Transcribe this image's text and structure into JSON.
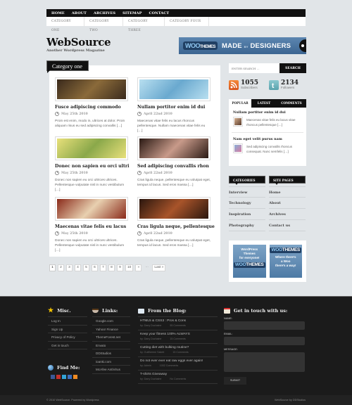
{
  "top_nav": [
    "HOME",
    "ABOUT",
    "ARCHIVES",
    "SITEMAP",
    "CONTACT"
  ],
  "category_nav": [
    "CATEGORY ONE",
    "CATEGORY TWO",
    "CATEGORY THREE",
    "CATEGORY FOUR"
  ],
  "logo": {
    "title": "WebSource",
    "tagline": "Another Wordpress Magazine"
  },
  "banner": {
    "woo": "WOO",
    "themes": "THEMES",
    "made": "MADE",
    "by": "BY",
    "designers": "DESIGNERS"
  },
  "main": {
    "category_title": "Category one",
    "posts": [
      {
        "title": "Fusce adipiscing commodo",
        "date": "May 25th 2010",
        "excerpt": "Proin est enim, modo in, ultrices at dolor. Proin aliquam risus eu sed adipiscing convallis […]",
        "colors": [
          "#3a2a1c",
          "#8a6a3a"
        ]
      },
      {
        "title": "Nullam portitor enim id dui",
        "date": "April 22nd 2010",
        "excerpt": "Maecenas vitae felis eu lacus rhoncus pellentesque. Nullam maecenas vitae felis eu […]",
        "colors": [
          "#b8dff0",
          "#6aa9cf"
        ]
      },
      {
        "title": "Donec non sapien eu orci ultri",
        "date": "May 25th 2010",
        "excerpt": "Donec non sapien eu orci ultrices ultrices. Pellentesque vulputate nisl in nunc vestibulum […]",
        "colors": [
          "#e8e07a",
          "#8aa84a"
        ]
      },
      {
        "title": "Sed adipiscing convallis rhon",
        "date": "April 22nd 2010",
        "excerpt": "Cras ligula neque, pellentesque eu volutpat eget, tempus id lacus. Sed eros massa […]",
        "colors": [
          "#2a1a14",
          "#c89a8a"
        ]
      },
      {
        "title": "Maecenas vitae felis eu lacus",
        "date": "May 25th 2010",
        "excerpt": "Donec non sapien eu orci ultrices ultrices. Pellentesque vulputate nisl in nunc vestibulum […]",
        "colors": [
          "#8a2a1a",
          "#e8d0b0"
        ]
      },
      {
        "title": "Cras ligula neque, pellentesque",
        "date": "April 22nd 2010",
        "excerpt": "Cras ligula neque, pellentesque eu volutpat eget, tempus id lacus. Sed eros massa […]",
        "colors": [
          "#2a160e",
          "#a8542a"
        ]
      }
    ]
  },
  "pagination": {
    "pages": [
      "1",
      "2",
      "3",
      "4",
      "5",
      "6",
      "7",
      "8",
      "9",
      "10"
    ],
    "next": "»",
    "dots": "...",
    "last": "Last »",
    "current": "1"
  },
  "sidebar": {
    "search": {
      "placeholder": "ENTER SEARCH ...",
      "button": "SEARCH"
    },
    "subscribers": {
      "count": "1055",
      "label": "Subscribers"
    },
    "followers": {
      "count": "2134",
      "label": "Followers"
    },
    "tabs": [
      "POPULAR",
      "LATEST",
      "COMMENTS"
    ],
    "active_tab": "POPULAR",
    "popular": [
      {
        "title": "Nullam portitor enim id dui",
        "excerpt": "Maecenas vitae felis eu lacus vitae rhoncus pellentesque […]"
      },
      {
        "title": "Nam eget velit purus nam",
        "excerpt": "Sed adipiscing convallis rhoncus consequat. Nunc semfelis […]"
      }
    ],
    "categories": {
      "title": "CATEGORIES",
      "items": [
        "Interview",
        "Technology",
        "Inspiration",
        "Photography"
      ]
    },
    "site_pages": {
      "title": "SITE PAGES",
      "items": [
        "Home",
        "About",
        "Archives",
        "Contact us"
      ]
    },
    "ads": [
      {
        "line1": "WordPress",
        "line2": "Themes",
        "line3": "for everyone!"
      },
      {
        "line1": "Where there's",
        "line2": "a Woo",
        "line3": "there's a way!"
      }
    ]
  },
  "footer": {
    "misc": {
      "title": "Misc.",
      "items": [
        "Log In",
        "Sign Up",
        "Privacy of Policy",
        "Get in touch"
      ]
    },
    "find_me": {
      "title": "Find Me:"
    },
    "links": {
      "title": "Links:",
      "items": [
        "Google.com",
        "Yahoo! Finance",
        "ThemeForest.net",
        "Envato",
        "DDStudios",
        "ioanki.com",
        "McAfee AntiVirus"
      ]
    },
    "blog": {
      "title": "From the Blog:",
      "items": [
        {
          "title": "HTML5 & CSS3 : Pros & Cons",
          "author": "by: Dany Duchaine",
          "comments": "55 Comments"
        },
        {
          "title": "Keep your fitness 100% ALWAYS",
          "author": "by: Dany Duchaine",
          "comments": "15 Comments"
        },
        {
          "title": "Cutting diet with bulking routine?",
          "author": "by: Guillherme Sabeti",
          "comments": "15 Comments"
        },
        {
          "title": "Do not ever ever eat raw eggs ever again!",
          "author": "by: Admin",
          "comments": "1002 Comments"
        },
        {
          "title": "T-shirts Giveaway",
          "author": "by: Dany Duchaine",
          "comments": "No Comments"
        }
      ]
    },
    "contact": {
      "title": "Get in touch with us:",
      "name_label": "NAME:",
      "email_label": "EMAIL:",
      "message_label": "MESSAGE:",
      "submit": "SUBMIT"
    },
    "copyright": "© 2010 WebSource. Powered by Wordpress",
    "credit": "WebSource by DDStudios"
  }
}
